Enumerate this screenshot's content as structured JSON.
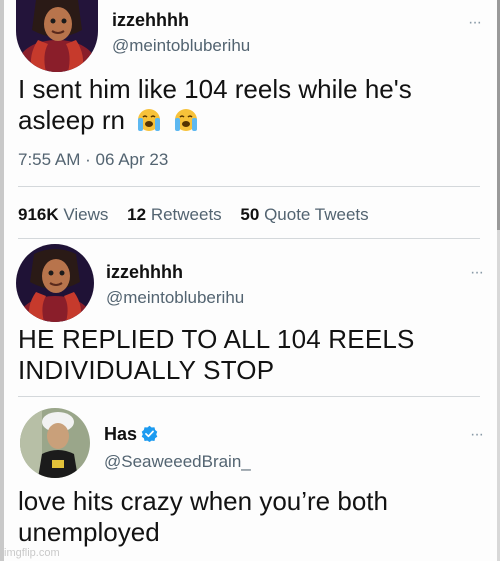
{
  "tweet1": {
    "name": "izzehhhh",
    "handle": "@meintobluberihu",
    "text": "I sent him like 104 reels while he's",
    "text_line2": "asleep rn",
    "emoji": [
      "loudly-crying-face",
      "loudly-crying-face"
    ],
    "time": "7:55 AM",
    "dot": "·",
    "date": "06 Apr 23",
    "stats": {
      "views_value": "916K",
      "views_label": "Views",
      "retweets_value": "12",
      "retweets_label": "Retweets",
      "quotes_value": "50",
      "quotes_label": "Quote Tweets"
    }
  },
  "tweet2": {
    "name": "izzehhhh",
    "handle": "@meintobluberihu",
    "more": "···",
    "line1": "HE REPLIED TO ALL 104 REELS",
    "line2": "INDIVIDUALLY STOP"
  },
  "tweet3": {
    "name": "Has",
    "handle": "@SeaweeedBrain_",
    "more": "···",
    "line1": "love hits crazy when you’re both",
    "line2": "unemployed"
  },
  "tweet1_more": "···",
  "watermark": "imgflip.com",
  "colors": {
    "text": "#0f1419",
    "secondary": "#536471",
    "verified": "#1d9bf0",
    "divider": "#d4d8db"
  }
}
